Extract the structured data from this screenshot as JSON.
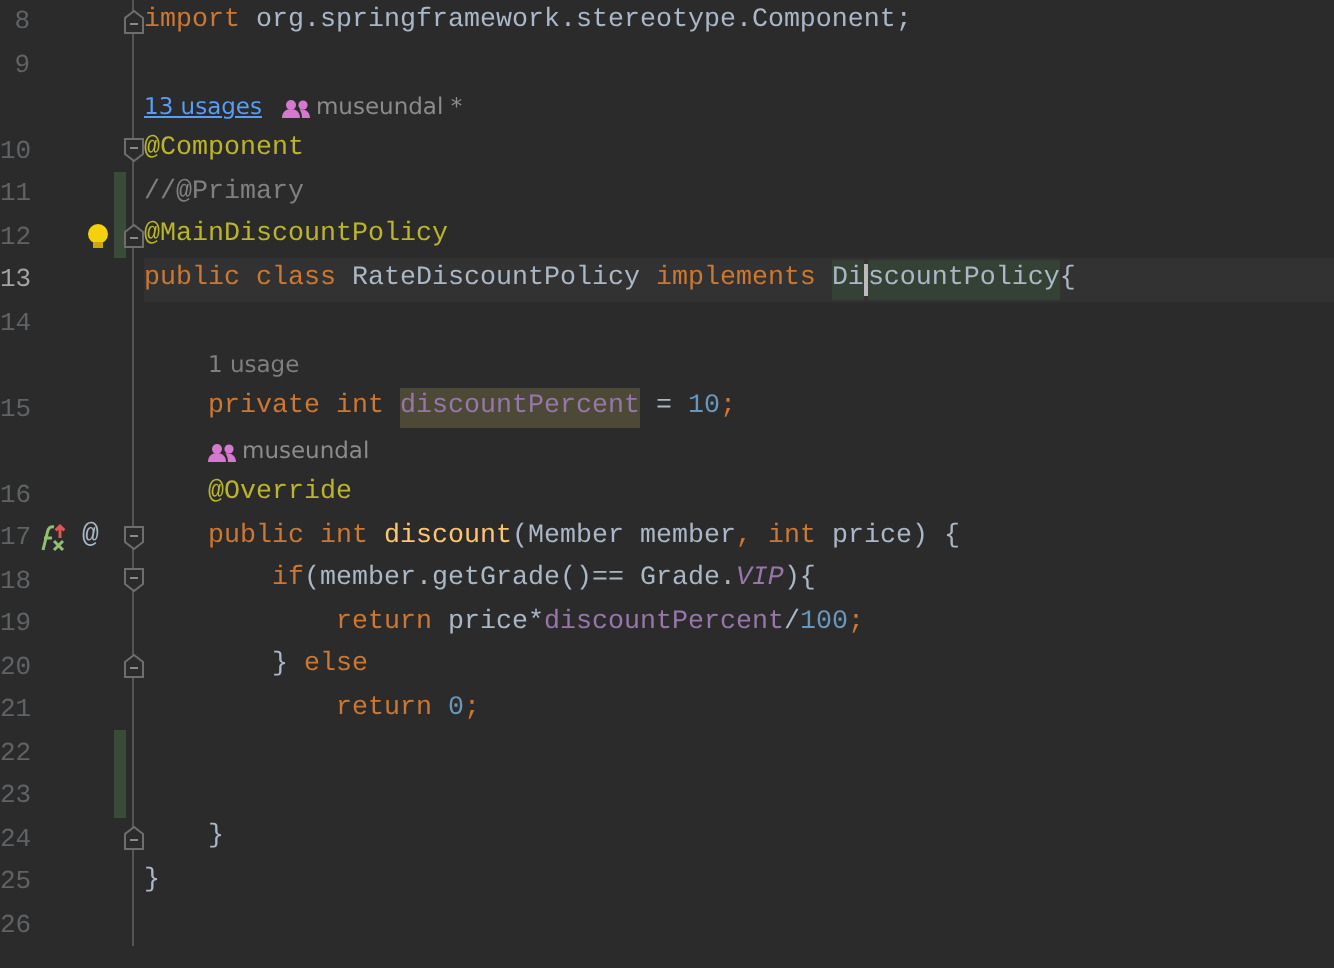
{
  "editor": {
    "rows": [
      {
        "number": "8",
        "fold_end": true,
        "tokens": [
          {
            "text": "import",
            "kind": "kw"
          },
          {
            "text": " org.springframework.stereotype.Component;",
            "kind": "plain"
          }
        ]
      },
      {
        "number": "9",
        "tokens": []
      },
      {
        "number": "10",
        "fold_start": true,
        "inlay": {
          "usages": "13 usages",
          "author": "museundal *"
        },
        "tokens": [
          {
            "text": "@Component",
            "kind": "ann"
          }
        ]
      },
      {
        "number": "11",
        "changed": true,
        "tokens": [
          {
            "text": "//@Primary",
            "kind": "comment"
          }
        ]
      },
      {
        "number": "12",
        "changed": true,
        "fold_end": true,
        "bulb": true,
        "tokens": [
          {
            "text": "@MainDiscountPolicy",
            "kind": "ann"
          }
        ]
      },
      {
        "number": "13",
        "current": true,
        "tokens": [
          {
            "text": "public class ",
            "kind": "kw"
          },
          {
            "text": "RateDiscountPolicy ",
            "kind": "plain"
          },
          {
            "text": "implements ",
            "kind": "kw"
          },
          {
            "text": "Di",
            "kind": "plain",
            "caret_highlight": true
          },
          {
            "kind": "caret"
          },
          {
            "text": "scountPolicy",
            "kind": "plain",
            "caret_highlight": true
          },
          {
            "text": "{",
            "kind": "plain"
          }
        ]
      },
      {
        "number": "14",
        "tokens": []
      },
      {
        "number": "15",
        "inlay": {
          "usages": "1 usage"
        },
        "tokens": [
          {
            "text": "    private int ",
            "kind": "kw"
          },
          {
            "text": "discountPercent",
            "kind": "field",
            "usage_highlight": true
          },
          {
            "text": " = ",
            "kind": "plain"
          },
          {
            "text": "10",
            "kind": "num"
          },
          {
            "text": ";",
            "kind": "kw"
          }
        ]
      },
      {
        "number": "16",
        "inlay": {
          "author": "museundal"
        },
        "tokens": [
          {
            "text": "    @Override",
            "kind": "ann"
          }
        ]
      },
      {
        "number": "17",
        "fold_start": true,
        "gutter": [
          {
            "kind": "icon"
          },
          {
            "kind": "char",
            "text": "@"
          }
        ],
        "tokens": [
          {
            "text": "    public int ",
            "kind": "kw"
          },
          {
            "text": "discount",
            "kind": "method"
          },
          {
            "text": "(Member member",
            "kind": "plain"
          },
          {
            "text": ", int ",
            "kind": "kw"
          },
          {
            "text": "price) {",
            "kind": "plain"
          }
        ]
      },
      {
        "number": "18",
        "fold_start": true,
        "tokens": [
          {
            "text": "        if",
            "kind": "kw"
          },
          {
            "text": "(member.getGrade()== Grade.",
            "kind": "plain"
          },
          {
            "text": "VIP",
            "kind": "static"
          },
          {
            "text": "){",
            "kind": "plain"
          }
        ]
      },
      {
        "number": "19",
        "tokens": [
          {
            "text": "            return ",
            "kind": "kw"
          },
          {
            "text": "price*",
            "kind": "plain"
          },
          {
            "text": "discountPercent",
            "kind": "field"
          },
          {
            "text": "/",
            "kind": "plain"
          },
          {
            "text": "100",
            "kind": "num"
          },
          {
            "text": ";",
            "kind": "kw"
          }
        ]
      },
      {
        "number": "20",
        "fold_end": true,
        "tokens": [
          {
            "text": "        }",
            "kind": "plain"
          },
          {
            "text": " else",
            "kind": "kw"
          }
        ]
      },
      {
        "number": "21",
        "tokens": [
          {
            "text": "            return ",
            "kind": "kw"
          },
          {
            "text": "0",
            "kind": "num"
          },
          {
            "text": ";",
            "kind": "kw"
          }
        ]
      },
      {
        "number": "22",
        "changed": true,
        "tokens": []
      },
      {
        "number": "23",
        "changed": true,
        "tokens": []
      },
      {
        "number": "24",
        "fold_end": true,
        "tokens": [
          {
            "text": "    }",
            "kind": "plain"
          }
        ]
      },
      {
        "number": "25",
        "tokens": [
          {
            "text": "}",
            "kind": "plain"
          }
        ]
      },
      {
        "number": "26",
        "tokens": []
      }
    ]
  }
}
